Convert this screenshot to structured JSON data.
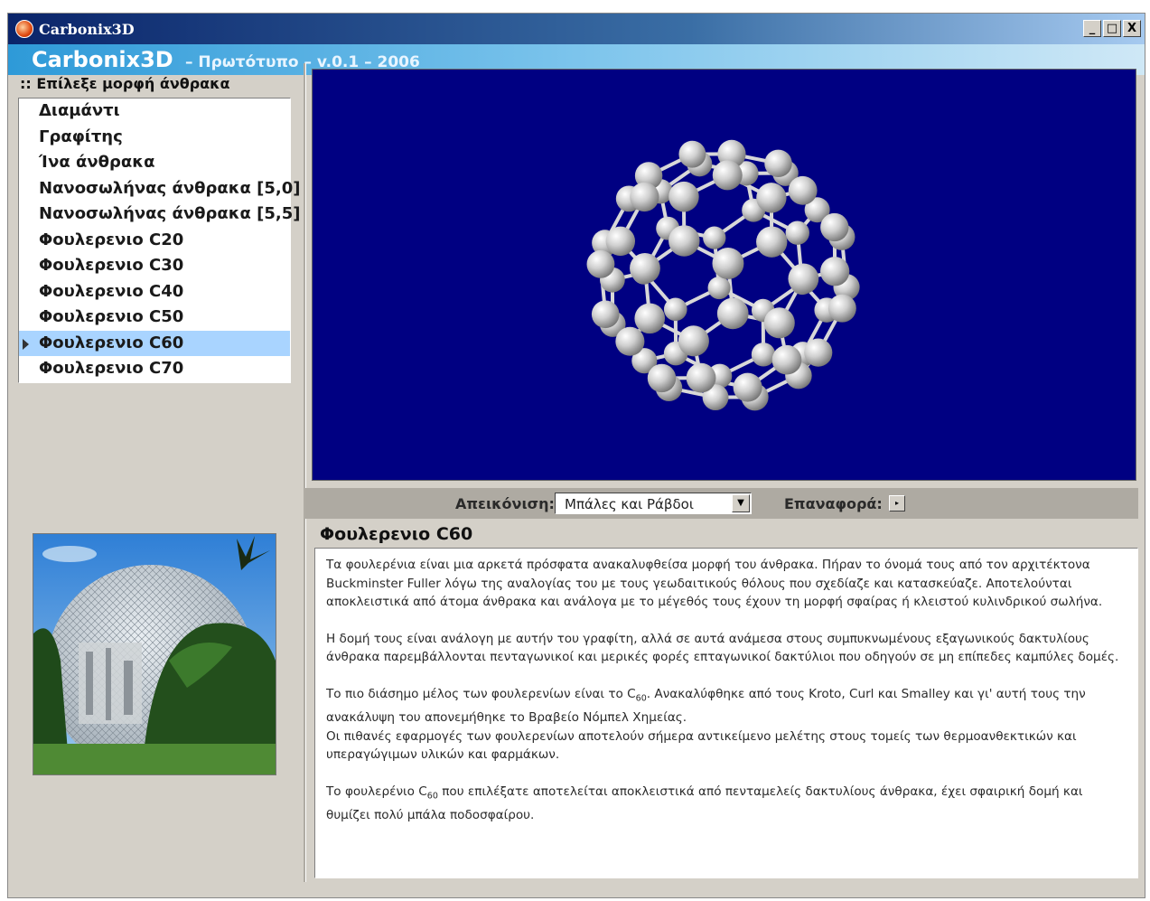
{
  "window": {
    "title": "Carbonix3D",
    "controls": [
      "_",
      "□",
      "X"
    ]
  },
  "banner": {
    "name": "Carbonix3D",
    "subtitle": "– Πρωτότυπο – v.0.1 – 2006"
  },
  "sidebar": {
    "caption": ":: Επίλεξε μορφή άνθρακα",
    "items": [
      {
        "label": "Διαμάντι"
      },
      {
        "label": "Γραφίτης"
      },
      {
        "label": "Ίνα άνθρακα"
      },
      {
        "label": "Νανοσωλήνας άνθρακα [5,0]"
      },
      {
        "label": "Νανοσωλήνας άνθρακα [5,5]"
      },
      {
        "label": "Φουλερενιο C20"
      },
      {
        "label": "Φουλερενιο C30"
      },
      {
        "label": "Φουλερενιο C40"
      },
      {
        "label": "Φουλερενιο C50"
      },
      {
        "label": "Φουλερενιο C60"
      },
      {
        "label": "Φουλερενιο C70"
      }
    ],
    "selected_index": 9
  },
  "colors": {
    "viewport_bg": "#000082",
    "selection": "#a9d4ff",
    "atom": "#c8c8c8"
  },
  "toolbar": {
    "display_label": "Απεικόνιση:",
    "display_value": "Μπάλες και Ράβδοι",
    "reset_label": "Επαναφορά:"
  },
  "description": {
    "title": "Φουλερενιο C60",
    "p1": "Τα φουλερένια είναι μια αρκετά πρόσφατα ανακαλυφθείσα μορφή του άνθρακα. Πήραν το όνομά τους από τον αρχιτέκτονα Buckminster Fuller λόγω της αναλογίας του με τους γεωδαιτικούς θόλους που σχεδίαζε και κατασκεύαζε. Αποτελούνται αποκλειστικά από άτομα άνθρακα και ανάλογα με το μέγεθός τους έχουν τη μορφή σφαίρας ή κλειστού κυλινδρικού σωλήνα.",
    "p2": "Η δομή τους είναι ανάλογη με αυτήν του γραφίτη, αλλά σε αυτά ανάμεσα στους συμπυκνωμένους εξαγωνικούς δακτυλίους άνθρακα παρεμβάλλονται πενταγωνικοί και μερικές φορές επταγωνικοί δακτύλιοι που οδηγούν σε μη επίπεδες καμπύλες δομές.",
    "p3a": "Το πιο διάσημο μέλος των φουλερενίων είναι το C",
    "p3sub": "60",
    "p3b": ". Ανακαλύφθηκε από τους Kroto, Curl και Smalley και γι' αυτή τους την ανακάλυψη του απονεμήθηκε το Βραβείο Νόμπελ Χημείας.",
    "p4": "Οι πιθανές εφαρμογές των φουλερενίων αποτελούν σήμερα αντικείμενο μελέτης στους τομείς των θερμοανθεκτικών και υπεραγώγιμων υλικών και φαρμάκων.",
    "p5a": "Το φουλερένιο C",
    "p5sub": "60",
    "p5b": " που επιλέξατε αποτελείται αποκλειστικά από πενταμελείς δακτυλίους άνθρακα, έχει σφαιρική δομή και θυμίζει πολύ μπάλα ποδοσφαίρου."
  }
}
